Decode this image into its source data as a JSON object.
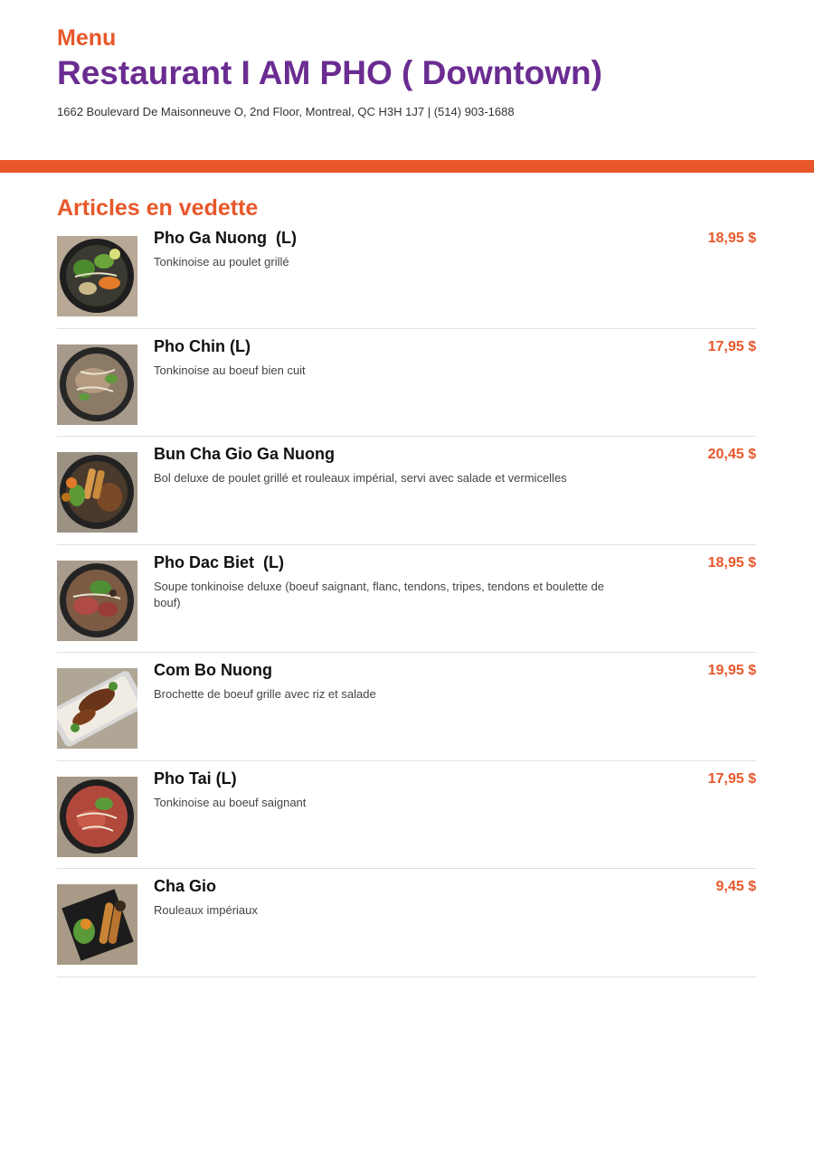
{
  "header": {
    "menu_label": "Menu",
    "restaurant_name": "Restaurant I AM PHO ( Downtown)",
    "address": "1662 Boulevard De Maisonneuve O, 2nd Floor, Montreal, QC H3H 1J7 | (514) 903-1688"
  },
  "colors": {
    "accent": "#e8572a",
    "title": "#6a2c91"
  },
  "featured": {
    "title": "Articles en vedette",
    "items": [
      {
        "name": "Pho Ga Nuong  (L)",
        "description": "Tonkinoise au poulet grillé",
        "price": "18,95 $",
        "image": "pho-ga-nuong-photo"
      },
      {
        "name": "Pho Chin (L)",
        "description": "Tonkinoise au boeuf bien cuit",
        "price": "17,95 $",
        "image": "pho-chin-photo"
      },
      {
        "name": "Bun Cha Gio Ga Nuong",
        "description": "Bol deluxe de poulet grillé et rouleaux impérial, servi avec salade et vermicelles",
        "price": "20,45 $",
        "image": "bun-cha-gio-ga-nuong-photo"
      },
      {
        "name": "Pho Dac Biet  (L)",
        "description": "Soupe tonkinoise deluxe (boeuf saignant, flanc, tendons, tripes, tendons et boulette de bouf)",
        "price": "18,95 $",
        "image": "pho-dac-biet-photo"
      },
      {
        "name": "Com Bo Nuong",
        "description": "Brochette de boeuf grille avec riz et salade",
        "price": "19,95 $",
        "image": "com-bo-nuong-photo"
      },
      {
        "name": "Pho Tai (L)",
        "description": "Tonkinoise au boeuf saignant",
        "price": "17,95 $",
        "image": "pho-tai-photo"
      },
      {
        "name": "Cha Gio",
        "description": "Rouleaux impériaux",
        "price": "9,45 $",
        "image": "cha-gio-photo"
      }
    ]
  }
}
